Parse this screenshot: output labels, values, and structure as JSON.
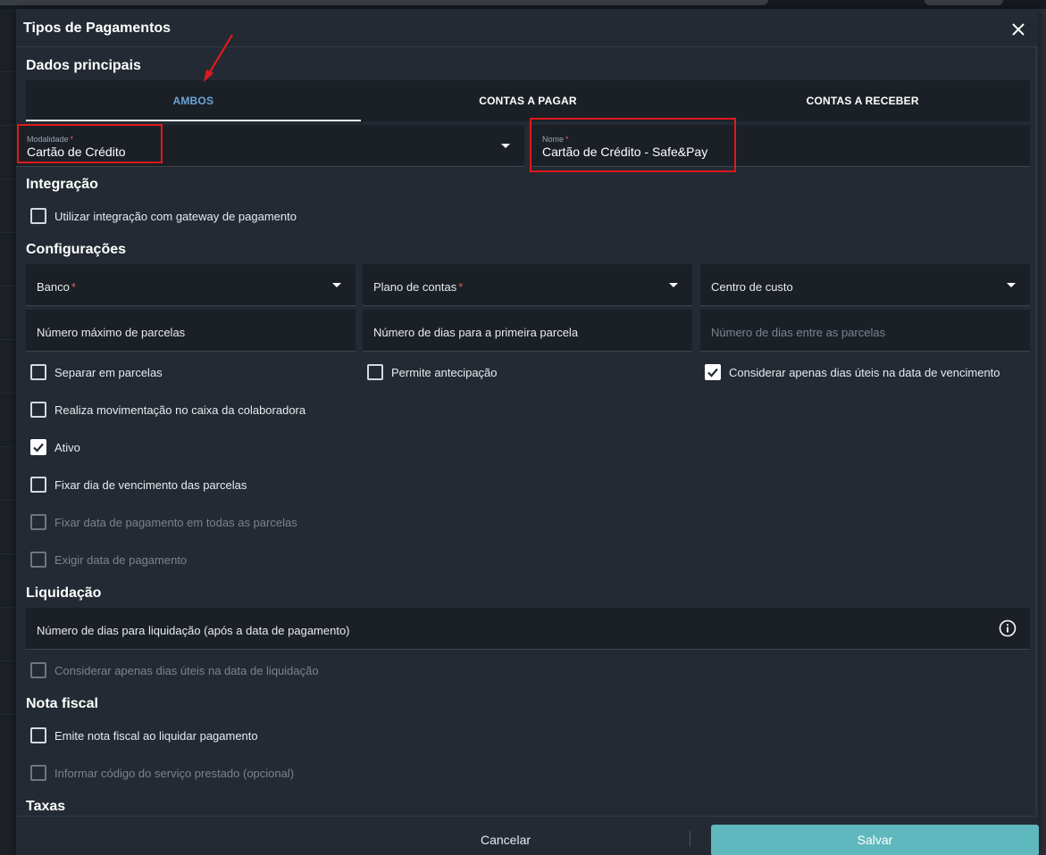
{
  "dialog": {
    "title": "Tipos de Pagamentos",
    "close_icon": "close-icon"
  },
  "sections": {
    "main": "Dados principais",
    "integration": "Integração",
    "config": "Configurações",
    "settlement": "Liquidação",
    "invoice": "Nota fiscal",
    "fees": "Taxas"
  },
  "tabs": [
    {
      "label": "AMBOS",
      "active": true
    },
    {
      "label": "CONTAS A PAGAR",
      "active": false
    },
    {
      "label": "CONTAS A RECEBER",
      "active": false
    }
  ],
  "fields": {
    "modalidade": {
      "label": "Modalidade",
      "value": "Cartão de Crédito"
    },
    "nome": {
      "label": "Nome",
      "value": "Cartão de Crédito - Safe&Pay"
    },
    "banco": {
      "label": "Banco"
    },
    "plano_contas": {
      "label": "Plano de contas"
    },
    "centro_custo": {
      "label": "Centro de custo"
    },
    "max_parcelas": {
      "label": "Número máximo de parcelas"
    },
    "dias_primeira": {
      "label": "Número de dias para a primeira parcela"
    },
    "dias_entre": {
      "label": "Número de dias entre as parcelas"
    },
    "dias_liquidacao": {
      "label": "Número de dias para liquidação (após a data de pagamento)"
    },
    "required_mark": "*"
  },
  "checkboxes": {
    "gateway": {
      "label": "Utilizar integração com gateway de pagamento",
      "checked": false
    },
    "separar": {
      "label": "Separar em parcelas",
      "checked": false
    },
    "antecipacao": {
      "label": "Permite antecipação",
      "checked": false
    },
    "dias_uteis_venc": {
      "label": "Considerar apenas dias úteis na data de vencimento",
      "checked": true
    },
    "movimentacao": {
      "label": "Realiza movimentação no caixa da colaboradora",
      "checked": false
    },
    "ativo": {
      "label": "Ativo",
      "checked": true
    },
    "fixar_dia": {
      "label": "Fixar dia de vencimento das parcelas",
      "checked": false
    },
    "fixar_data": {
      "label": "Fixar data de pagamento em todas as parcelas",
      "checked": false,
      "disabled": true
    },
    "exigir_data": {
      "label": "Exigir data de pagamento",
      "checked": false,
      "disabled": true
    },
    "dias_uteis_liq": {
      "label": "Considerar apenas dias úteis na data de liquidação",
      "checked": false,
      "disabled": true
    },
    "emite_nf": {
      "label": "Emite nota fiscal ao liquidar pagamento",
      "checked": false
    },
    "codigo_servico": {
      "label": "Informar código do serviço prestado (opcional)",
      "checked": false,
      "disabled": true
    }
  },
  "footer": {
    "cancel": "Cancelar",
    "save": "Salvar"
  },
  "colors": {
    "accent_tab": "#6aa4d8",
    "save_button": "#5fb8bd",
    "annotation": "#e0191c"
  }
}
